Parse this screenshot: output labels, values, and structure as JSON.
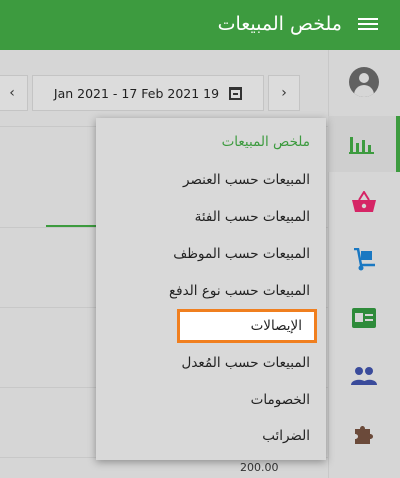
{
  "app": {
    "title": "ملخص المبيعات",
    "menu_icon": "hamburger-icon",
    "accent_color": "#3d9b3f",
    "highlight_color": "#f07f1f"
  },
  "date_filter": {
    "prev_label": "‹",
    "next_label": "›",
    "range": "Jan 2021 - 17 Feb 2021 19",
    "icon": "calendar-icon"
  },
  "chart": {
    "tick_label": "200.00"
  },
  "sidebar": {
    "items": [
      {
        "name": "account",
        "icon": "account-circle-icon",
        "color": "#616161"
      },
      {
        "name": "reports",
        "icon": "bar-chart-icon",
        "color": "#3d9b3f",
        "active": true
      },
      {
        "name": "sales",
        "icon": "basket-icon",
        "color": "#d62566"
      },
      {
        "name": "inventory",
        "icon": "dolly-icon",
        "color": "#1a78c2"
      },
      {
        "name": "employees",
        "icon": "id-card-icon",
        "color": "#2e8b3a"
      },
      {
        "name": "customers",
        "icon": "people-icon",
        "color": "#3a4b9b"
      },
      {
        "name": "apps",
        "icon": "puzzle-icon",
        "color": "#6b4a3a"
      }
    ]
  },
  "report_menu": {
    "items": [
      {
        "label": "ملخص المبيعات",
        "state": "selected"
      },
      {
        "label": "المبيعات حسب العنصر"
      },
      {
        "label": "المبيعات حسب الفئة"
      },
      {
        "label": "المبيعات حسب الموظف"
      },
      {
        "label": "المبيعات حسب نوع الدفع"
      },
      {
        "label": "الإيصالات",
        "state": "highlighted"
      },
      {
        "label": "المبيعات حسب المُعدل"
      },
      {
        "label": "الخصومات"
      },
      {
        "label": "الضرائب"
      }
    ]
  }
}
